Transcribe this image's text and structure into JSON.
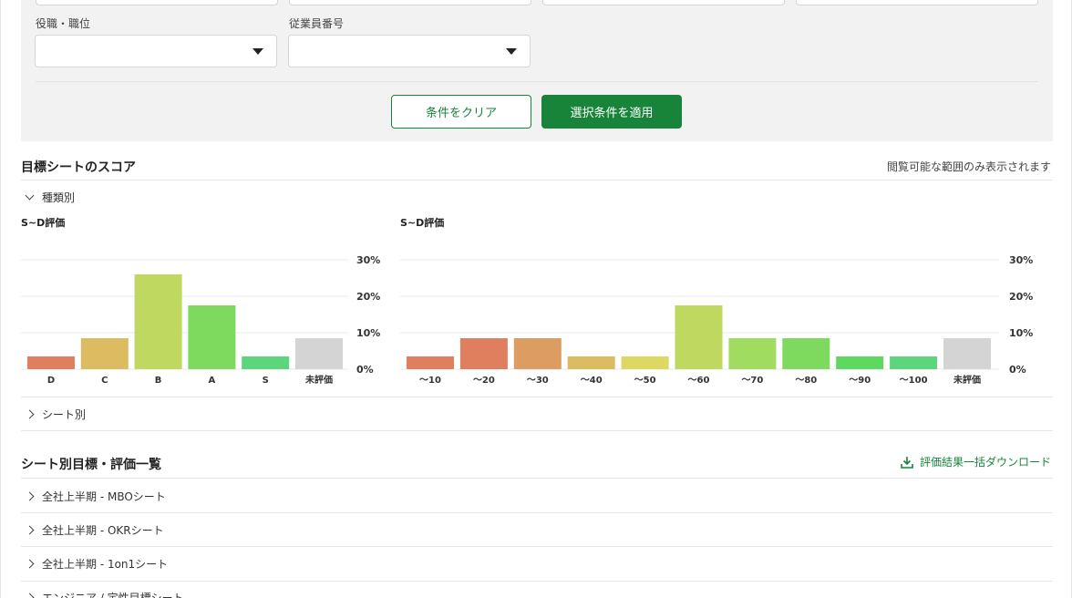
{
  "filters": {
    "position_label": "役職・職位",
    "employee_no_label": "従業員番号",
    "clear_button": "条件をクリア",
    "apply_button": "選択条件を適用"
  },
  "score_section": {
    "title": "目標シートのスコア",
    "note": "閲覧可能な範囲のみ表示されます",
    "by_type_label": "種類別",
    "by_sheet_label": "シート別"
  },
  "list_section": {
    "title": "シート別目標・評価一覧",
    "download_label": "評価結果一括ダウンロード",
    "items": [
      {
        "label": "全社上半期 - MBOシート"
      },
      {
        "label": "全社上半期 - OKRシート"
      },
      {
        "label": "全社上半期 - 1on1シート"
      },
      {
        "label": "エンジニア / 定性目標シート"
      }
    ]
  },
  "colors": {
    "accent": "#17843a",
    "panel_bg": "#f2f2f2"
  },
  "chart_data": [
    {
      "type": "bar",
      "title": "S~D評価",
      "categories": [
        "D",
        "C",
        "B",
        "A",
        "S",
        "未評価"
      ],
      "values": [
        3.5,
        8.5,
        26,
        17.5,
        3.5,
        8.5
      ],
      "colors": [
        "#e07f60",
        "#dcbc61",
        "#bed860",
        "#7ed95f",
        "#5dd57d",
        "#d4d4d4"
      ],
      "ylim": [
        0,
        30
      ],
      "yticks": [
        "0%",
        "10%",
        "20%",
        "30%"
      ],
      "grid": true
    },
    {
      "type": "bar",
      "title": "S~D評価",
      "categories": [
        "〜10",
        "〜20",
        "〜30",
        "〜40",
        "〜50",
        "〜60",
        "〜70",
        "〜80",
        "〜90",
        "〜100",
        "未評価"
      ],
      "values": [
        3.5,
        8.5,
        8.5,
        3.5,
        3.5,
        17.5,
        8.5,
        8.5,
        3.5,
        3.5,
        8.5
      ],
      "colors": [
        "#e07f60",
        "#e07f60",
        "#dd9c61",
        "#dcbc61",
        "#dcd861",
        "#bed860",
        "#9fdc60",
        "#7ed95f",
        "#5fd85f",
        "#5dd57d",
        "#d4d4d4"
      ],
      "ylim": [
        0,
        30
      ],
      "yticks": [
        "0%",
        "10%",
        "20%",
        "30%"
      ],
      "grid": true
    }
  ]
}
